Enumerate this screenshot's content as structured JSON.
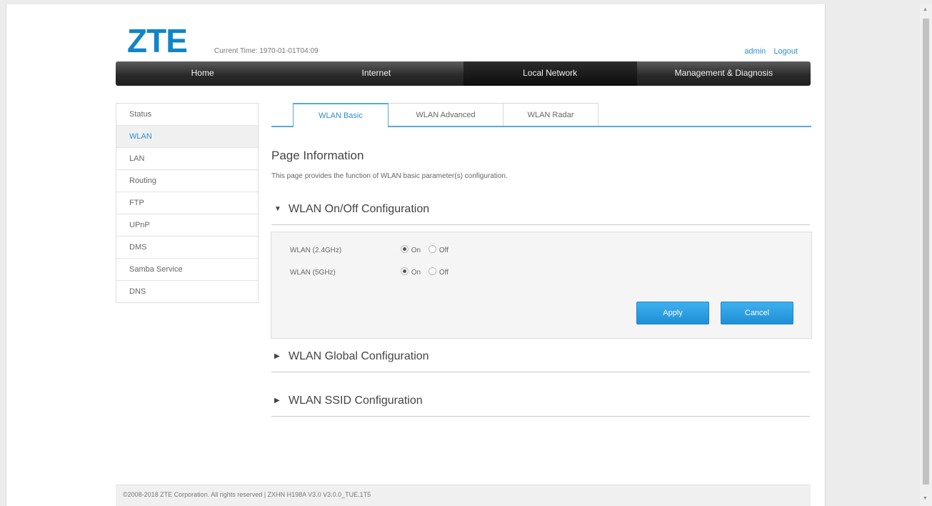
{
  "header": {
    "logo_text": "ZTE",
    "current_time": "Current Time: 1970-01-01T04:09",
    "user": "admin",
    "logout": "Logout"
  },
  "nav": {
    "items": [
      "Home",
      "Internet",
      "Local Network",
      "Management & Diagnosis"
    ],
    "active": "Local Network"
  },
  "sidebar": {
    "items": [
      "Status",
      "WLAN",
      "LAN",
      "Routing",
      "FTP",
      "UPnP",
      "DMS",
      "Samba Service",
      "DNS"
    ],
    "active": "WLAN"
  },
  "tabs": {
    "items": [
      "WLAN Basic",
      "WLAN Advanced",
      "WLAN Radar"
    ],
    "active": "WLAN Basic"
  },
  "page": {
    "title": "Page Information",
    "description": "This page provides the function of WLAN basic parameter(s) configuration."
  },
  "sections": {
    "onoff": "WLAN On/Off Configuration",
    "global": "WLAN Global Configuration",
    "ssid": "WLAN SSID Configuration"
  },
  "wlan": {
    "rows": [
      {
        "label": "WLAN (2.4GHz)",
        "on": "On",
        "off": "Off",
        "selected": "On"
      },
      {
        "label": "WLAN (5GHz)",
        "on": "On",
        "off": "Off",
        "selected": "On"
      }
    ]
  },
  "buttons": {
    "apply": "Apply",
    "cancel": "Cancel"
  },
  "footer": {
    "text": "©2008-2018 ZTE Corporation. All rights reserved  |  ZXHN H198A V3.0 V3.0.0_TUE.1T5"
  },
  "icons": {
    "expanded": "triangle-down-icon",
    "collapsed": "triangle-right-icon"
  },
  "colors": {
    "brand": "#0e86c9",
    "accent": "#2a8fd4",
    "button": "#2a9de2",
    "nav_bg": "#2b2b2b"
  }
}
